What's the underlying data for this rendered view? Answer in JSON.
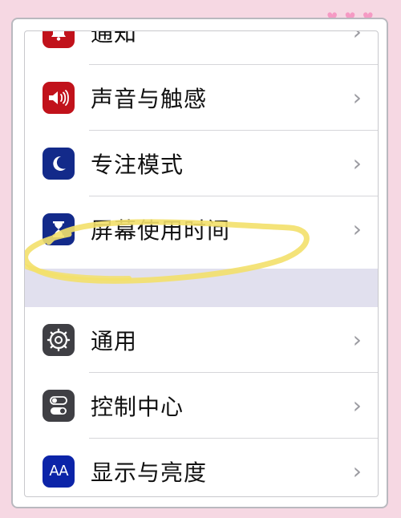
{
  "decor": {
    "hearts": [
      "♥",
      "♥",
      "♥"
    ]
  },
  "chevron": "›",
  "rows": [
    {
      "label": "通知",
      "icon": "bell-icon"
    },
    {
      "label": "声音与触感",
      "icon": "speaker-icon"
    },
    {
      "label": "专注模式",
      "icon": "moon-icon"
    },
    {
      "label": "屏幕使用时间",
      "icon": "hourglass-icon"
    },
    {
      "label": "通用",
      "icon": "gear-icon"
    },
    {
      "label": "控制中心",
      "icon": "toggles-icon"
    },
    {
      "label": "显示与亮度",
      "icon": "text-size-icon",
      "icon_text": "AA"
    }
  ],
  "colors": {
    "background": "#f6d8e3",
    "red_icon": "#c1121b",
    "navy_icon": "#132a8a",
    "dark_icon": "#3f3f44",
    "blue_icon": "#0c24a8",
    "highlight": "#f3e06a",
    "hearts": "#f59ac4"
  }
}
